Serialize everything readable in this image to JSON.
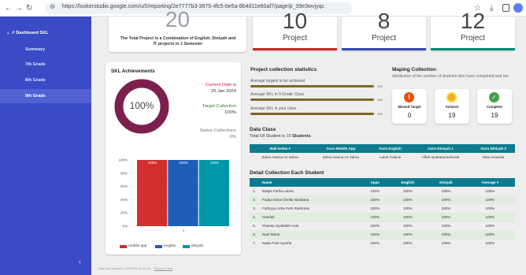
{
  "browser": {
    "url": "https://lookerstudio.google.com/u/0/reporting/2e7777b3-3875-4fc5-be5a-8b4d11e60af7/page/p_39e3wvjyqc"
  },
  "sidebar": {
    "title": "Dashboard SKL",
    "items": [
      {
        "label": "Summary"
      },
      {
        "label": "7th Grade"
      },
      {
        "label": "8th Grade"
      },
      {
        "label": "9th Grade"
      }
    ]
  },
  "top": {
    "total_number": "20",
    "total_desc": "The Total Project is a Combination of English, Diniyah and IT projects in 1 Semester",
    "cards": [
      {
        "number": "10",
        "label": "Project",
        "color": "#c62828"
      },
      {
        "number": "8",
        "label": "Project",
        "color": "#3949ab"
      },
      {
        "number": "12",
        "label": "Project",
        "color": "#00897b"
      }
    ]
  },
  "achievements": {
    "title": "SKL Achievements",
    "donut_value": "100%",
    "current_label": "Current Date is",
    "current_value": "25 Jan 2024",
    "target_label": "Target Collection",
    "target_value": "100%",
    "status_label": "Status Collections",
    "status_value": "0%"
  },
  "chart_data": {
    "type": "bar",
    "categories": [
      "s"
    ],
    "series": [
      {
        "name": "mobile app",
        "values": [
          100
        ],
        "color": "#d32f2f"
      },
      {
        "name": "english",
        "values": [
          100
        ],
        "color": "#1e5eb8"
      },
      {
        "name": "diniyah",
        "values": [
          100
        ],
        "color": "#0097a7"
      }
    ],
    "yticks": [
      "100%",
      "80%",
      "60%",
      "40%",
      "20%",
      "0%"
    ],
    "ylim": [
      0,
      100
    ],
    "bar_labels": [
      "100%",
      "100%",
      "100%"
    ],
    "xtick": "s"
  },
  "stats": {
    "title": "Project collection statistics",
    "rows": [
      {
        "label": "Average targets to be achieved",
        "value": "100"
      },
      {
        "label": "Average SKL In 9 Grade Class",
        "value": "100"
      },
      {
        "label": "Average SKL in your class",
        "value": "100"
      }
    ]
  },
  "mapping": {
    "title": "Maping Collection",
    "desc": "distribution of the number of students who have completed and not",
    "items": [
      {
        "label": "Missed Target",
        "value": "0",
        "color": "#e65100"
      },
      {
        "label": "Achieve",
        "value": "19",
        "color": "#f9a825"
      },
      {
        "label": "Complete",
        "value": "19",
        "color": "#43a047"
      }
    ]
  },
  "dataclass": {
    "title": "Data Class",
    "sub_prefix": "Total Of Student is",
    "sub_count": "19",
    "sub_suffix": "Students",
    "headers": [
      "Wali Kelas",
      "Guru Mobile App",
      "Guru English",
      "Guru Diniyah 1",
      "Guru Diniyah 2"
    ],
    "row": [
      "Zahra Hasna Az Zahra",
      "Zahra Hasna Az Zahra",
      "Luluk Yulianti",
      "Affah Qudratunnahmah",
      "Elsa Amanda"
    ]
  },
  "detail": {
    "title": "Detail Collection Each Student",
    "headers": [
      "Name",
      "Apps",
      "English",
      "Diniyah",
      "Average"
    ],
    "rows": [
      {
        "no": "1.",
        "name": "Balqis Farha Lubna",
        "apps": "100%",
        "english": "100%",
        "diniyah": "100%",
        "avg": "100%"
      },
      {
        "no": "2.",
        "name": "Fadya Isma Chelila Nurdiana",
        "apps": "100%",
        "english": "100%",
        "diniyah": "100%",
        "avg": "100%"
      },
      {
        "no": "3.",
        "name": "Fathiyya Azka Putri Rakhman",
        "apps": "100%",
        "english": "100%",
        "diniyah": "100%",
        "avg": "100%"
      },
      {
        "no": "4.",
        "name": "Hanifah",
        "apps": "100%",
        "english": "100%",
        "diniyah": "100%",
        "avg": "100%"
      },
      {
        "no": "5.",
        "name": "Khansa Syahidah Aula",
        "apps": "100%",
        "english": "100%",
        "diniyah": "100%",
        "avg": "100%"
      },
      {
        "no": "6.",
        "name": "Nael Maria",
        "apps": "100%",
        "english": "100%",
        "diniyah": "100%",
        "avg": "100%"
      },
      {
        "no": "7.",
        "name": "Nada Putri Syarifa",
        "apps": "100%",
        "english": "100%",
        "diniyah": "100%",
        "avg": "100%"
      }
    ]
  },
  "footer": {
    "text": "Data Last Updated: 1/25/2024 09:10:05",
    "link": "Privacy Policy"
  }
}
